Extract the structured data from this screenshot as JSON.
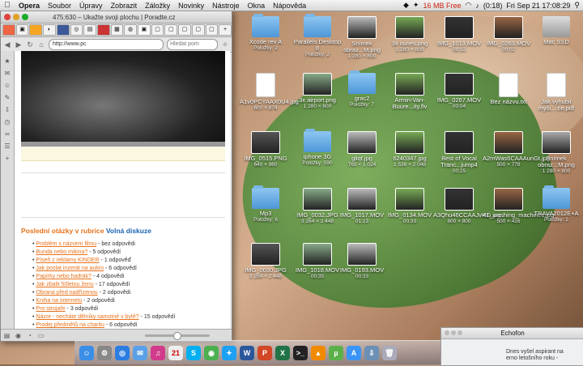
{
  "menubar": {
    "app": "Opera",
    "items": [
      "Soubor",
      "Úpravy",
      "Zobrazit",
      "Záložky",
      "Novinky",
      "Nástroje",
      "Okna",
      "Nápověda"
    ],
    "memory": "16 MB Free",
    "battery": "(0:18)",
    "clock": "Fri Sep 21  17:08:29"
  },
  "desktop": [
    {
      "name": "Xcode rev A",
      "sub": "Položky: 2",
      "kind": "folder"
    },
    {
      "name": "Parallels Desktop 8",
      "sub": "Položky: 2",
      "kind": "folder"
    },
    {
      "name": "Snímek obraz...M.png",
      "sub": "1 280 × 800",
      "kind": "image"
    },
    {
      "name": "3x itunes.png",
      "sub": "1 280 × 800",
      "kind": "image"
    },
    {
      "name": "IMG_1013.MOV",
      "sub": "08:32",
      "kind": "image"
    },
    {
      "name": "IMG_0263.MOV",
      "sub": "00:02",
      "kind": "image"
    },
    {
      "name": "Mac SSD",
      "sub": "",
      "kind": "drive"
    },
    {
      "name": "A1v0PCYAAX0U4.jpg",
      "sub": "600 × 874",
      "kind": "document"
    },
    {
      "name": "3x airport.png",
      "sub": "1 280 × 800",
      "kind": "image"
    },
    {
      "name": "grac2",
      "sub": "Položky: 7",
      "kind": "folder"
    },
    {
      "name": "Armin-Van-Buure...ity.flv",
      "sub": "",
      "kind": "image"
    },
    {
      "name": "IMG_0267.MOV",
      "sub": "00:04",
      "kind": "image"
    },
    {
      "name": "Bez názvu.txt",
      "sub": "",
      "kind": "document"
    },
    {
      "name": "Jak vyhubit myši....ce.pdf",
      "sub": "",
      "kind": "document"
    },
    {
      "name": "IMG_0515.PNG",
      "sub": "640 × 960",
      "kind": "image"
    },
    {
      "name": "iphone 3G",
      "sub": "Položky: 590",
      "kind": "folder"
    },
    {
      "name": "gliqf.jpg",
      "sub": "765 × 1 024",
      "kind": "image"
    },
    {
      "name": "6240347.jpg",
      "sub": "1 536 × 2 048",
      "kind": "image"
    },
    {
      "name": "Best of Vocal Tranc...jump4",
      "sub": "00:25",
      "kind": "image"
    },
    {
      "name": "A2mWas6CAAAunGt.jpg",
      "sub": "500 × 778",
      "kind": "image"
    },
    {
      "name": "Snímek obraz...M.png",
      "sub": "1 280 × 800",
      "kind": "image"
    },
    {
      "name": "Mp3",
      "sub": "Položky: 6",
      "kind": "folder"
    },
    {
      "name": "IMG_0032.JPG",
      "sub": "3 264 × 2 448",
      "kind": "image"
    },
    {
      "name": "IMG_1017.MOV",
      "sub": "01:13",
      "kind": "image"
    },
    {
      "name": "IMG_0134.MOV",
      "sub": "00:33",
      "kind": "image"
    },
    {
      "name": "A3Qhu46CCAAJvHG.jpg",
      "sub": "600 × 800",
      "kind": "image"
    },
    {
      "name": "41_washing_machines.jpg",
      "sub": "500 × 416",
      "kind": "image"
    },
    {
      "name": "TRAVA2012E+A",
      "sub": "Položky: 2",
      "kind": "folder"
    },
    {
      "name": "IMG_0030.JPG",
      "sub": "3 264 × 2 448",
      "kind": "image"
    },
    {
      "name": "IMG_1018.MOV",
      "sub": "00:35",
      "kind": "image"
    },
    {
      "name": "IMG_0193.MOV",
      "sub": "00:33",
      "kind": "image"
    }
  ],
  "browser": {
    "title": "475:630 – Ukažte svoji plochu | Poradte.cz",
    "url": "http://www.pc",
    "search_placeholder": "Hledat pom",
    "section_heading": "Poslední otázky v rubrice",
    "section_link": "Volná diskuze",
    "questions": [
      {
        "link": "Problém s názvem filmu",
        "meta": " - bez odpovědi"
      },
      {
        "link": "Bunda nebo mikina?",
        "meta": " - 5 odpovědí"
      },
      {
        "link": "Píseň z reklamy KINDER",
        "meta": " - 1 odpověď"
      },
      {
        "link": "Jak poslat inzerát na aukro",
        "meta": " - 6 odpovědí"
      },
      {
        "link": "Papírky nebo hadrák?",
        "meta": " - 4 odpovědi"
      },
      {
        "link": "Jak zbalit 50letou ženu",
        "meta": " - 17 odpovědí"
      },
      {
        "link": "Obrana před nadřízenou",
        "meta": " - 2 odpovědi"
      },
      {
        "link": "Kniha na internetu",
        "meta": " - 2 odpovědi"
      },
      {
        "link": "Pro strojaře",
        "meta": " - 3 odpovědi"
      },
      {
        "link": "Názor - necháte dělníky samotné v bytě?",
        "meta": " - 15 odpovědí"
      },
      {
        "link": "Prodej předmětů na charitu",
        "meta": " - 6 odpovědí"
      }
    ]
  },
  "echofon": {
    "title": "Echofon",
    "text1": "Dnes vyšel aspirant na",
    "text2": "erno letošního roku -"
  },
  "dock": [
    "finder",
    "system-preferences",
    "safari",
    "mail",
    "itunes",
    "calendar",
    "skype",
    "chrome",
    "twitter",
    "word",
    "powerpoint",
    "excel",
    "terminal",
    "vlc",
    "utorrent",
    "app-store",
    "downloads",
    "trash"
  ],
  "colors": {
    "accent_orange": "#e8711a",
    "link_blue": "#1b64b5",
    "folder_blue": "#5ea7e2"
  }
}
